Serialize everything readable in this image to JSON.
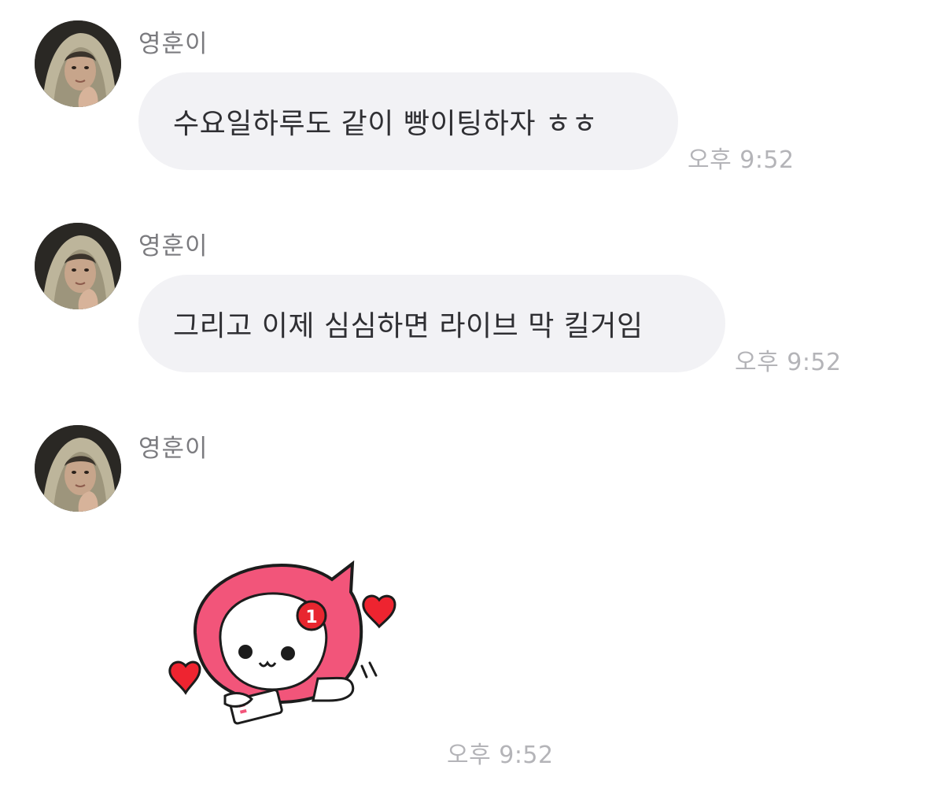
{
  "chat": {
    "messages": [
      {
        "sender": "영훈이",
        "text": "수요일하루도 같이 빵이팅하자 ㅎㅎ",
        "time": "오후 9:52"
      },
      {
        "sender": "영훈이",
        "text": "그리고 이제 심심하면 라이브 막 킬거임",
        "time": "오후 9:52"
      },
      {
        "sender": "영훈이",
        "sticker": "pink-hooded-character-with-hearts-and-phone",
        "sticker_badge": "1",
        "time": "오후 9:52"
      }
    ]
  },
  "colors": {
    "bubble_bg": "#f2f2f5",
    "sender_text": "#7b7b7f",
    "time_text": "#b4b4b8",
    "message_text": "#2f2f33",
    "sticker_pink": "#f2557a",
    "sticker_badge_red": "#e8262f",
    "heart_red": "#ee2430"
  },
  "icons": {
    "avatar": "profile-photo-hooded-person"
  }
}
